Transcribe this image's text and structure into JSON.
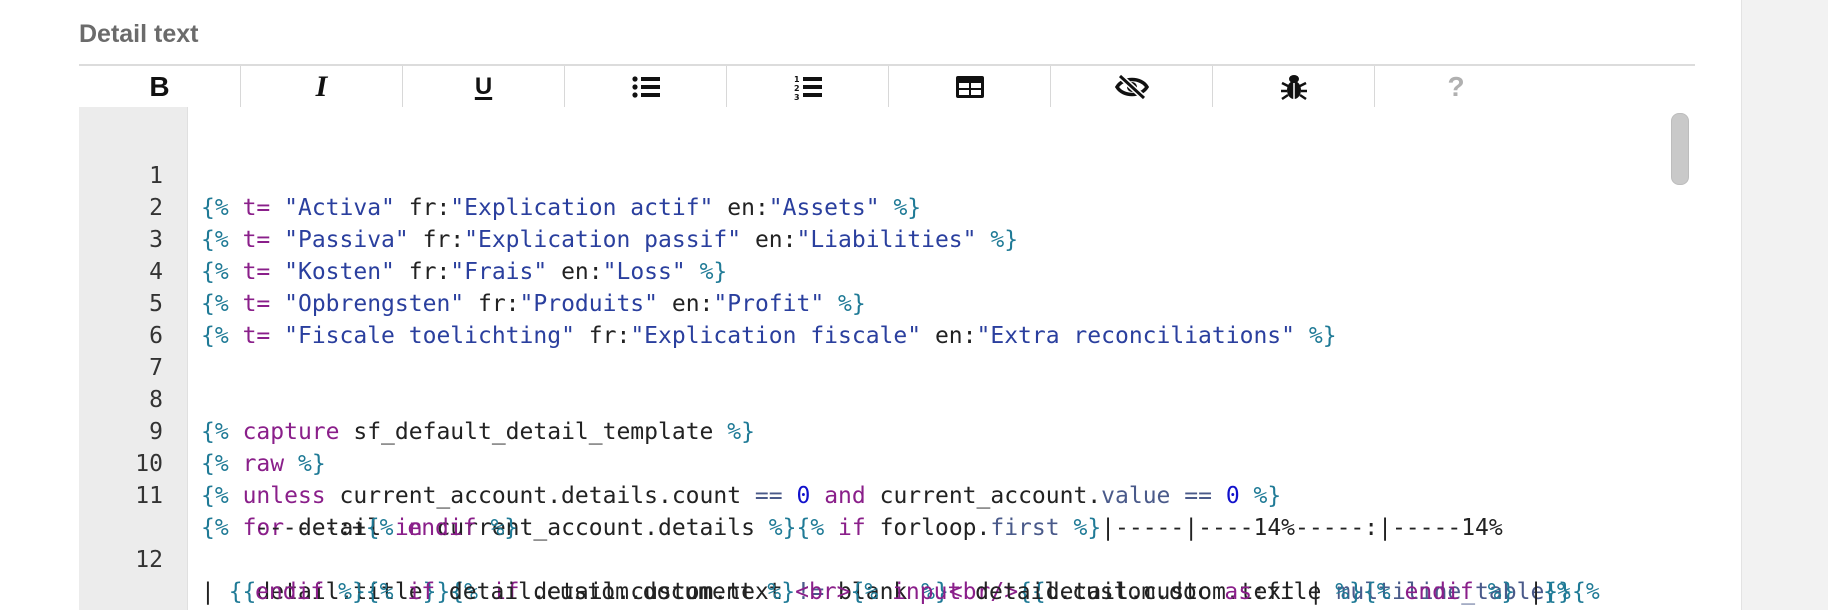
{
  "section": {
    "title": "Detail text"
  },
  "toolbar": {
    "buttons": [
      {
        "name": "bold-button",
        "icon": "bold-icon",
        "label": "B"
      },
      {
        "name": "italic-button",
        "icon": "italic-icon",
        "label": "I"
      },
      {
        "name": "underline-button",
        "icon": "underline-icon",
        "label": "U"
      },
      {
        "name": "bullet-list-button",
        "icon": "bullet-list-icon"
      },
      {
        "name": "numbered-list-button",
        "icon": "numbered-list-icon"
      },
      {
        "name": "table-button",
        "icon": "table-icon"
      },
      {
        "name": "hide-button",
        "icon": "eye-slash-icon"
      },
      {
        "name": "debug-button",
        "icon": "bug-icon"
      },
      {
        "name": "help-button",
        "icon": "question-icon",
        "label": "?"
      }
    ]
  },
  "editor": {
    "line_numbers": [
      "1",
      "2",
      "3",
      "4",
      "5",
      "6",
      "7",
      "8",
      "9",
      "10",
      "11",
      "",
      "12",
      "",
      ""
    ],
    "line1": {
      "t": "\"Activa\"",
      "fr": "\"Explication actif\"",
      "en": "\"Assets\""
    },
    "line2": {
      "t": "\"Passiva\"",
      "fr": "\"Explication passif\"",
      "en": "\"Liabilities\""
    },
    "line3": {
      "t": "\"Kosten\"",
      "fr": "\"Frais\"",
      "en": "\"Loss\""
    },
    "line4": {
      "t": "\"Opbrengsten\"",
      "fr": "\"Produits\"",
      "en": "\"Profit\""
    },
    "line5": {
      "t": "\"Fiscale toelichting\"",
      "fr": "\"Explication fiscale\"",
      "en": "\"Extra reconciliations\""
    },
    "line8_name": "sf_default_detail_template",
    "line11_table": "|-----|----14%-----:|-----14%",
    "line11_cont": "------:+",
    "colors": {
      "delimiter": "#1f7a96",
      "keyword": "#8a1f8a",
      "string": "#2a3f9e",
      "number": "#1111cc"
    }
  }
}
